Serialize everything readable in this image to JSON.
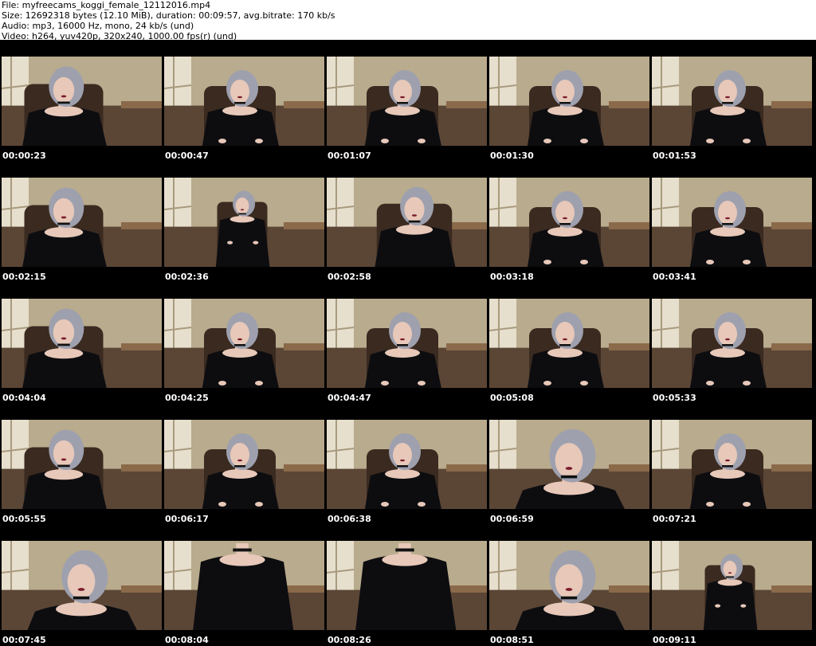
{
  "header": {
    "file_line": "File: myfreecams_koggi_female_12112016.mp4",
    "size_line": "Size: 12692318 bytes (12.10 MiB), duration: 00:09:57, avg.bitrate: 170 kb/s",
    "audio_line": "Audio: mp3, 16000 Hz, mono, 24 kb/s (und)",
    "video_line": "Video: h264, yuv420p, 320x240, 1000.00 fps(r) (und)"
  },
  "thumbnails": [
    {
      "timestamp": "00:00:23",
      "pose": "lean-left"
    },
    {
      "timestamp": "00:00:47",
      "pose": "center"
    },
    {
      "timestamp": "00:01:07",
      "pose": "center"
    },
    {
      "timestamp": "00:01:30",
      "pose": "center"
    },
    {
      "timestamp": "00:01:53",
      "pose": "center"
    },
    {
      "timestamp": "00:02:15",
      "pose": "lean-left"
    },
    {
      "timestamp": "00:02:36",
      "pose": "far"
    },
    {
      "timestamp": "00:02:58",
      "pose": "lean-right"
    },
    {
      "timestamp": "00:03:18",
      "pose": "center"
    },
    {
      "timestamp": "00:03:41",
      "pose": "center"
    },
    {
      "timestamp": "00:04:04",
      "pose": "lean-left"
    },
    {
      "timestamp": "00:04:25",
      "pose": "center"
    },
    {
      "timestamp": "00:04:47",
      "pose": "center"
    },
    {
      "timestamp": "00:05:08",
      "pose": "center"
    },
    {
      "timestamp": "00:05:33",
      "pose": "center"
    },
    {
      "timestamp": "00:05:55",
      "pose": "lean-left"
    },
    {
      "timestamp": "00:06:17",
      "pose": "center"
    },
    {
      "timestamp": "00:06:38",
      "pose": "center"
    },
    {
      "timestamp": "00:06:59",
      "pose": "close"
    },
    {
      "timestamp": "00:07:21",
      "pose": "center"
    },
    {
      "timestamp": "00:07:45",
      "pose": "close"
    },
    {
      "timestamp": "00:08:04",
      "pose": "torso"
    },
    {
      "timestamp": "00:08:26",
      "pose": "torso"
    },
    {
      "timestamp": "00:08:51",
      "pose": "close"
    },
    {
      "timestamp": "00:09:11",
      "pose": "far"
    }
  ],
  "colors": {
    "sheet_background": "#000000",
    "header_background": "#ffffff",
    "header_text": "#000000",
    "timestamp_text": "#ffffff",
    "wall": "#b9ab8d",
    "shelf": "#e7dfcd",
    "carpet": "#5b4636",
    "sweater": "#0d0d10",
    "chair": "#3a2a20",
    "skin": "#e7c8b9",
    "hair": "#9ea0ae"
  }
}
